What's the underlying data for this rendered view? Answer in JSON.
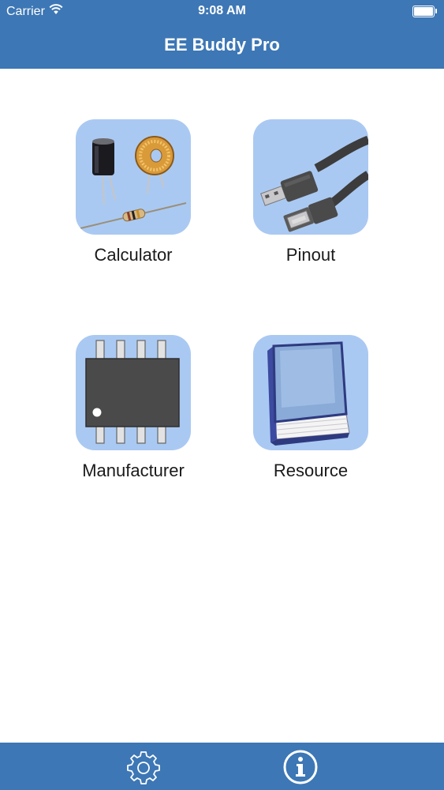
{
  "status_bar": {
    "carrier": "Carrier",
    "wifi_icon": "wifi-icon",
    "time": "9:08 AM",
    "battery_icon": "battery-icon",
    "battery_level": 1.0
  },
  "header": {
    "title": "EE Buddy Pro"
  },
  "menu": {
    "items": [
      {
        "label": "Calculator",
        "icon": "electronic-components-icon"
      },
      {
        "label": "Pinout",
        "icon": "usb-cable-icon"
      },
      {
        "label": "Manufacturer",
        "icon": "ic-chip-icon"
      },
      {
        "label": "Resource",
        "icon": "book-icon"
      }
    ]
  },
  "tab_bar": {
    "items": [
      {
        "icon": "settings-gear-icon"
      },
      {
        "icon": "info-icon"
      }
    ]
  },
  "colors": {
    "header_bg": "#3d77b5",
    "tile_bg": "#aac9f2",
    "text": "#1a1a1a",
    "white": "#ffffff"
  }
}
